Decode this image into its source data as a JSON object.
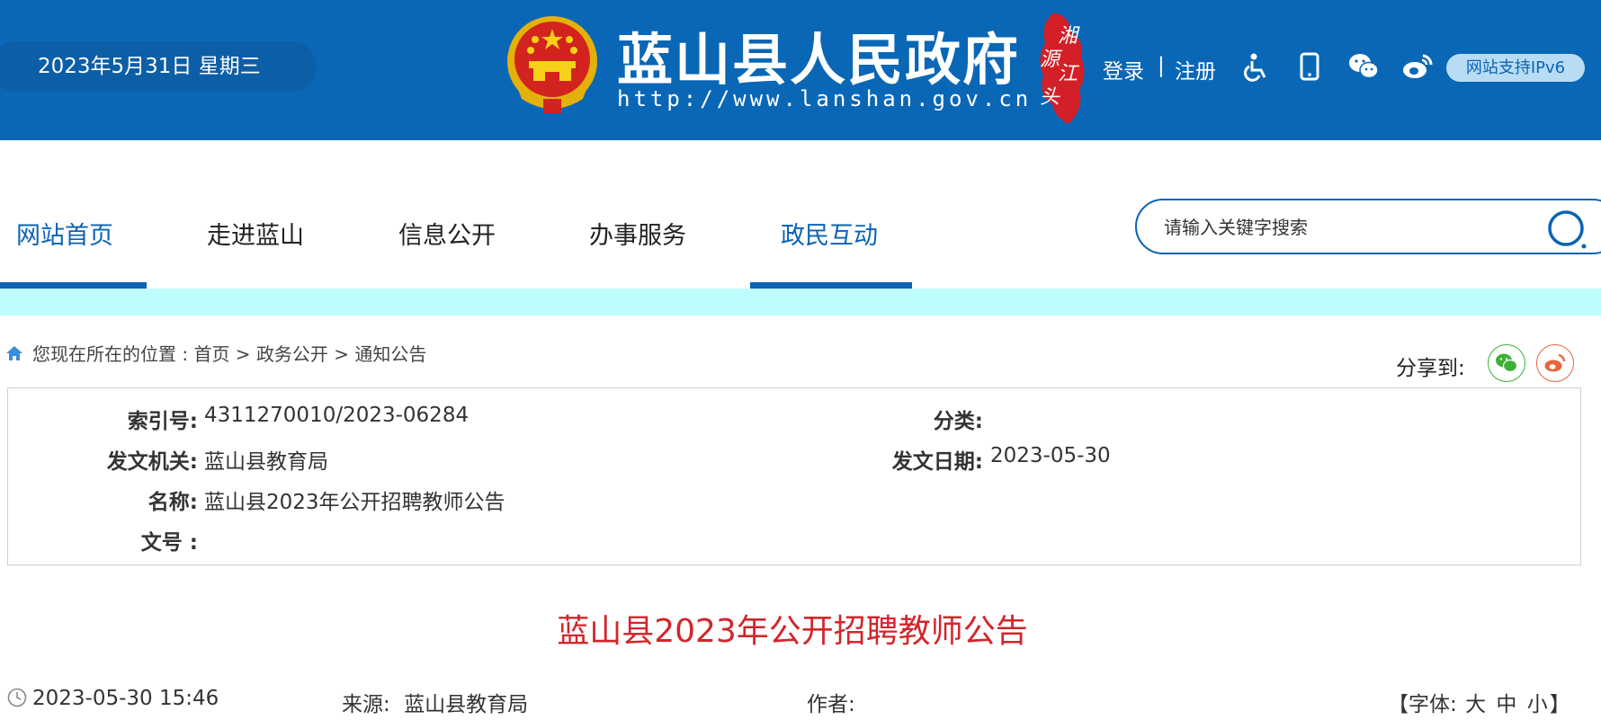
{
  "header": {
    "date": "2023年5月31日 星期三",
    "site_title": "蓝山县人民政府",
    "site_url": "http://www.lanshan.gov.cn",
    "seal_text": [
      "湘",
      "江",
      "源",
      "头"
    ],
    "login": "登录",
    "separator": "|",
    "register": "注册",
    "icons": [
      "accessibility-icon",
      "mobile-icon",
      "wechat-icon",
      "weibo-icon"
    ],
    "ipv6_badge": "网站支持IPv6"
  },
  "nav": {
    "items": [
      {
        "label": "网站首页",
        "active": true
      },
      {
        "label": "走进蓝山",
        "active": false
      },
      {
        "label": "信息公开",
        "active": false
      },
      {
        "label": "办事服务",
        "active": false
      },
      {
        "label": "政民互动",
        "active": true
      }
    ],
    "search_placeholder": "请输入关键字搜索"
  },
  "breadcrumb": {
    "prefix": "您现在所在的位置 : ",
    "items": [
      "首页",
      "政务公开",
      "通知公告"
    ],
    "separator": " > "
  },
  "share": {
    "label": "分享到:",
    "targets": [
      "wechat",
      "weibo"
    ]
  },
  "info": {
    "index_label": "索引号:",
    "index_value": "4311270010/2023-06284",
    "category_label": "分类:",
    "category_value": "",
    "issuer_label": "发文机关:",
    "issuer_value": "蓝山县教育局",
    "date_label": "发文日期:",
    "date_value": "2023-05-30",
    "name_label": "名称:",
    "name_value": "蓝山县2023年公开招聘教师公告",
    "docno_label": "文号 :",
    "docno_value": ""
  },
  "article": {
    "title": "蓝山县2023年公开招聘教师公告",
    "datetime": "2023-05-30 15:46",
    "source_label": "来源:",
    "source_value": "蓝山县教育局",
    "author_label": "作者:",
    "author_value": "",
    "font_label": "【字体:",
    "font_large": "大",
    "font_medium": "中",
    "font_small": "小",
    "font_close": "】"
  },
  "colors": {
    "header_bg": "#0a67b6",
    "brand_blue": "#0b63b5",
    "title_red": "#d2262b",
    "band_cyan": "#bffdfd"
  }
}
